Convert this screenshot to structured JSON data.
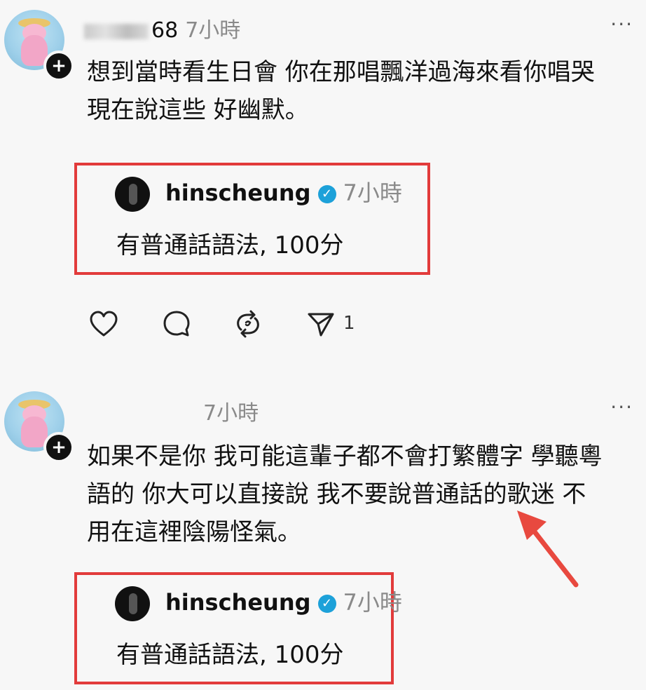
{
  "post1": {
    "username_suffix": "68",
    "time": "7小時",
    "more": "···",
    "text_lines": [
      "想到當時看生日會 你在那唱飄洋過海來看你唱哭",
      "現在說這些 好幽默。"
    ],
    "reply": {
      "name": "hinscheung",
      "time": "7小時",
      "text": "有普通話語法, 100分"
    },
    "actions": {
      "share_count": "1"
    }
  },
  "post2": {
    "time": "7小時",
    "more": "···",
    "text_lines": [
      "如果不是你 我可能這輩子都不會打繁體字 學聽粵",
      "語的 你大可以直接說 我不要說普通話的歌迷 不",
      "用在這裡陰陽怪氣。"
    ],
    "reply": {
      "name": "hinscheung",
      "time": "7小時",
      "text": "有普通話語法, 100分"
    }
  },
  "colors": {
    "highlight_border": "#e23b3b",
    "verified": "#1da1d9",
    "arrow": "#e8493f"
  },
  "icons": [
    "plus-icon",
    "heart-icon",
    "comment-icon",
    "repost-icon",
    "share-icon",
    "verified-icon",
    "more-icon",
    "arrow-annotation"
  ]
}
